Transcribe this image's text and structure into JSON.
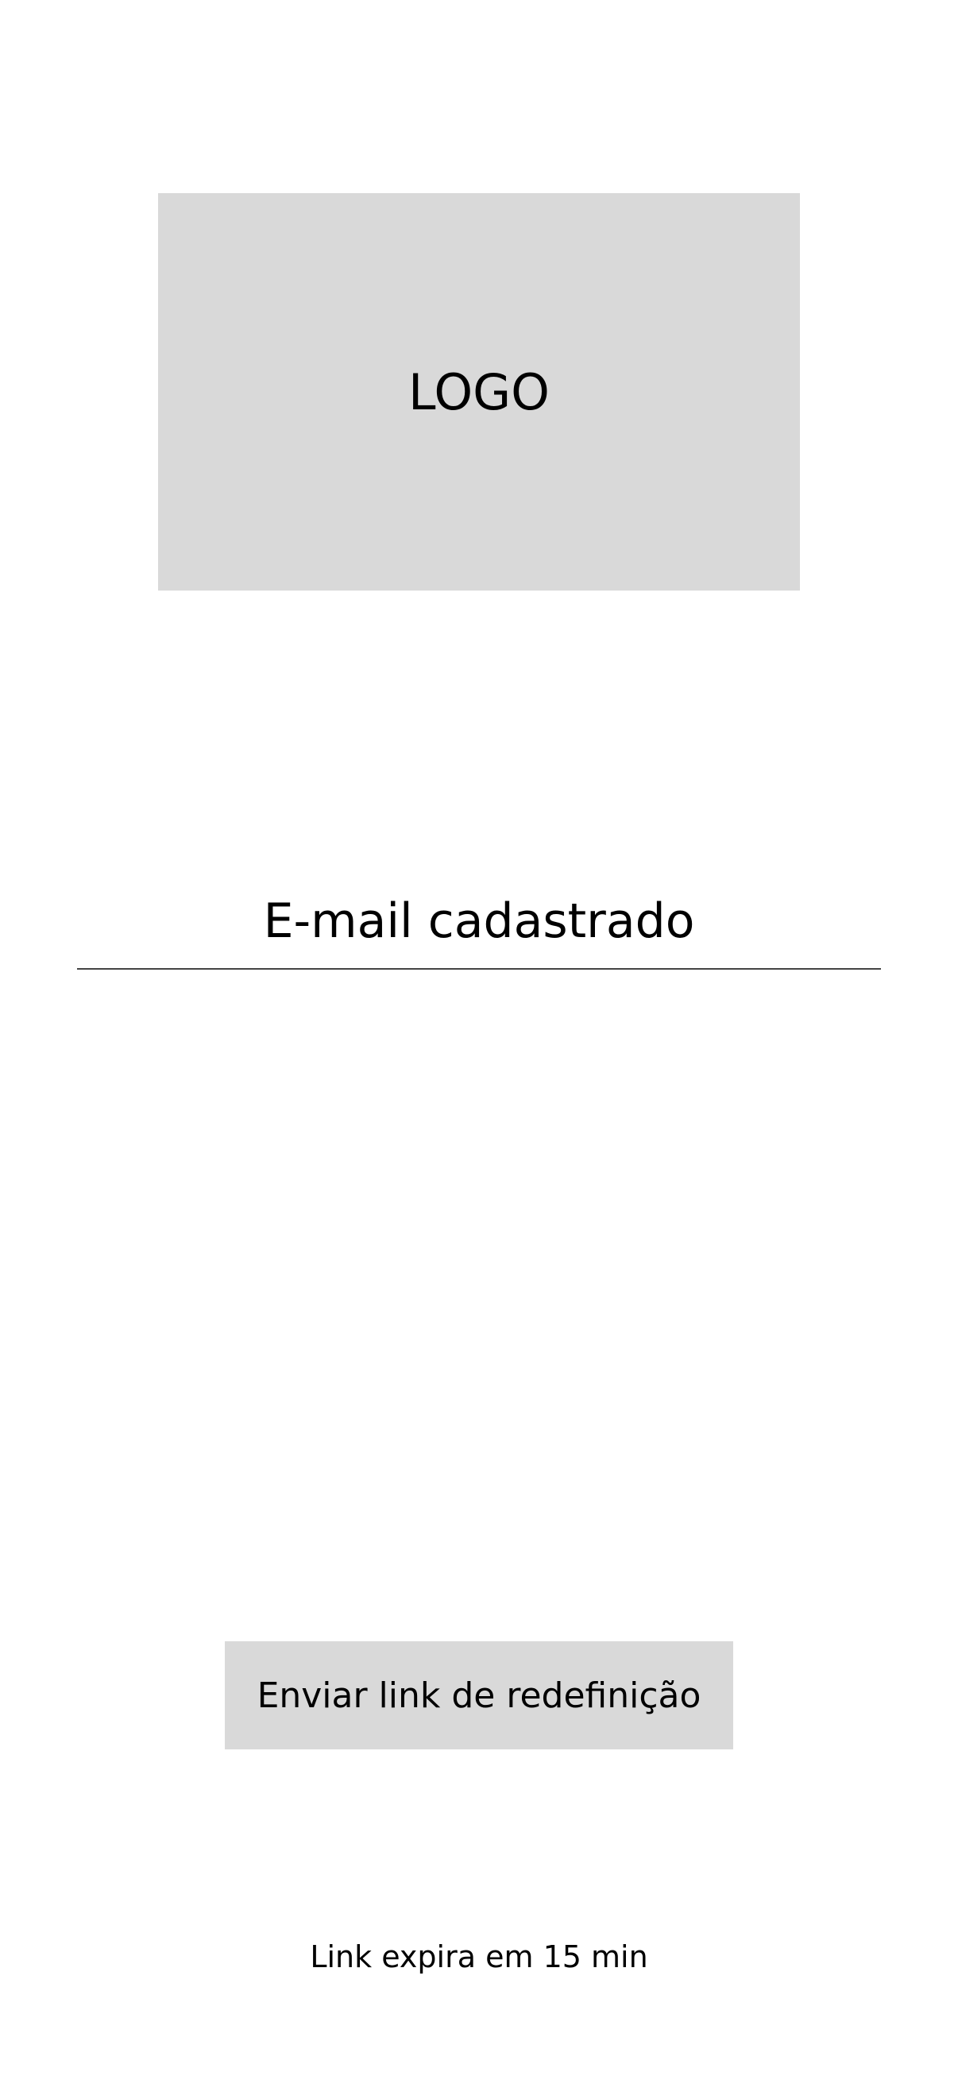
{
  "logo": {
    "label": "LOGO"
  },
  "email_field": {
    "placeholder": "E-mail cadastrado",
    "value": ""
  },
  "send_button": {
    "label": "Enviar link de redefinição"
  },
  "expiry_note": {
    "text": "Link expira em 15 min"
  },
  "colors": {
    "placeholder_fill": "#d9d9d9",
    "text": "#000000",
    "background": "#ffffff"
  }
}
